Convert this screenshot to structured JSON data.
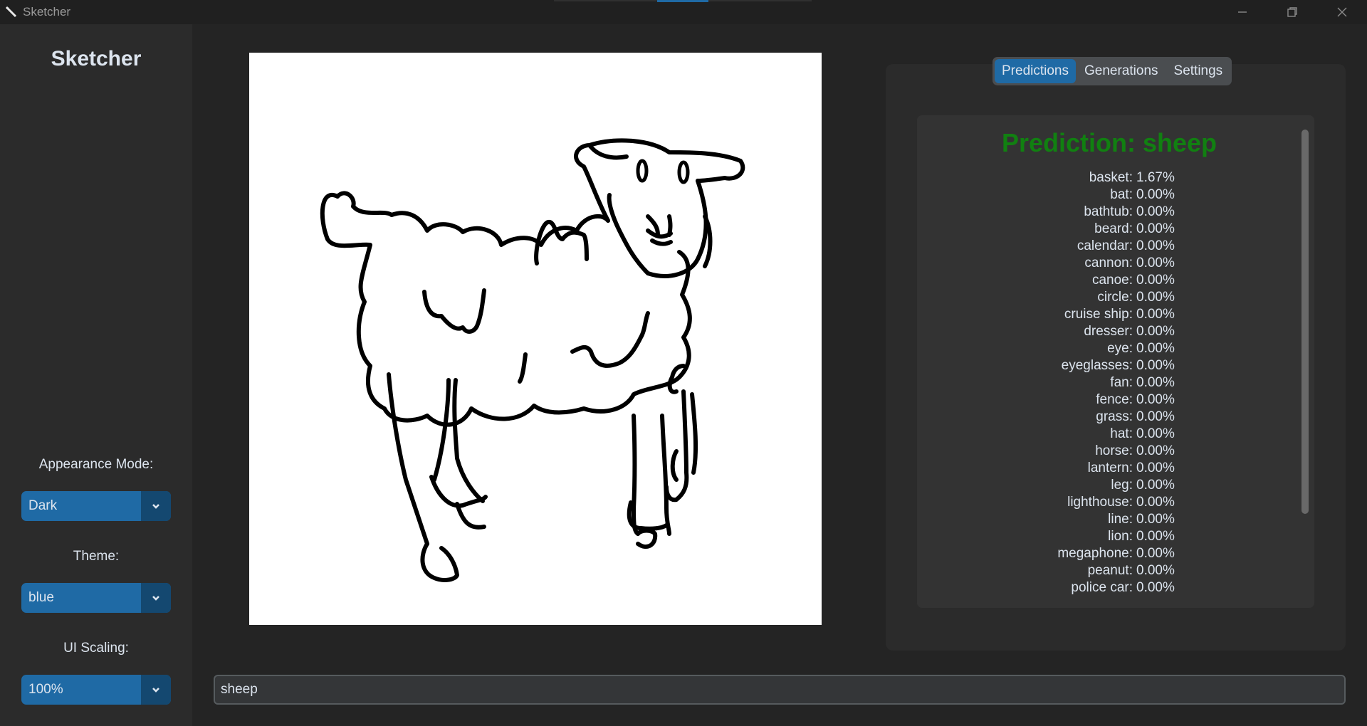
{
  "window": {
    "title": "Sketcher",
    "icon": "pencil-icon"
  },
  "sidebar": {
    "brand": "Sketcher",
    "appearance": {
      "label": "Appearance Mode:",
      "value": "Dark"
    },
    "theme": {
      "label": "Theme:",
      "value": "blue"
    },
    "scaling": {
      "label": "UI Scaling:",
      "value": "100%"
    }
  },
  "tabs": [
    {
      "label": "Predictions",
      "active": true
    },
    {
      "label": "Generations",
      "active": false
    },
    {
      "label": "Settings",
      "active": false
    }
  ],
  "prediction": {
    "title": "Prediction: sheep",
    "title_color": "#118011",
    "scores": [
      {
        "label": "basket:",
        "value": "1.67%"
      },
      {
        "label": "bat:",
        "value": "0.00%"
      },
      {
        "label": "bathtub:",
        "value": "0.00%"
      },
      {
        "label": "beard:",
        "value": "0.00%"
      },
      {
        "label": "calendar:",
        "value": "0.00%"
      },
      {
        "label": "cannon:",
        "value": "0.00%"
      },
      {
        "label": "canoe:",
        "value": "0.00%"
      },
      {
        "label": "circle:",
        "value": "0.00%"
      },
      {
        "label": "cruise ship:",
        "value": "0.00%"
      },
      {
        "label": "dresser:",
        "value": "0.00%"
      },
      {
        "label": "eye:",
        "value": "0.00%"
      },
      {
        "label": "eyeglasses:",
        "value": "0.00%"
      },
      {
        "label": "fan:",
        "value": "0.00%"
      },
      {
        "label": "fence:",
        "value": "0.00%"
      },
      {
        "label": "grass:",
        "value": "0.00%"
      },
      {
        "label": "hat:",
        "value": "0.00%"
      },
      {
        "label": "horse:",
        "value": "0.00%"
      },
      {
        "label": "lantern:",
        "value": "0.00%"
      },
      {
        "label": "leg:",
        "value": "0.00%"
      },
      {
        "label": "lighthouse:",
        "value": "0.00%"
      },
      {
        "label": "line:",
        "value": "0.00%"
      },
      {
        "label": "lion:",
        "value": "0.00%"
      },
      {
        "label": "megaphone:",
        "value": "0.00%"
      },
      {
        "label": "peanut:",
        "value": "0.00%"
      },
      {
        "label": "police car:",
        "value": "0.00%"
      }
    ]
  },
  "entry": {
    "value": "sheep"
  },
  "colors": {
    "accent": "#1f6aa5",
    "accent_dark": "#144870",
    "background": "#242424",
    "sidebar": "#2b2b2b"
  }
}
